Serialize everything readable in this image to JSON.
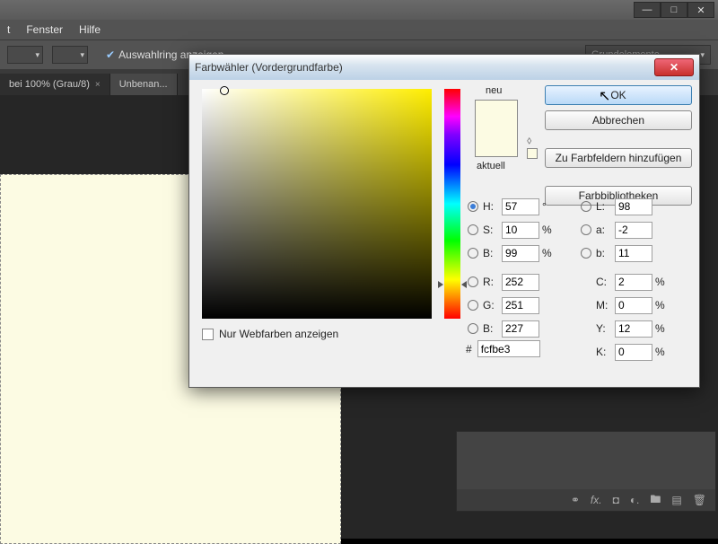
{
  "menu": {
    "fenster": "Fenster",
    "hilfe": "Hilfe"
  },
  "options": {
    "auswahlring": "Auswahlring anzeigen",
    "preset": "Grundelemente"
  },
  "tabs": {
    "t1": "bei 100% (Grau/8)",
    "t2": "Unbenan..."
  },
  "dialog": {
    "title": "Farbwähler (Vordergrundfarbe)",
    "ok": "OK",
    "cancel": "Abbrechen",
    "addswatch": "Zu Farbfeldern hinzufügen",
    "libs": "Farbbibliotheken",
    "neu": "neu",
    "aktuell": "aktuell",
    "webonly": "Nur Webfarben anzeigen",
    "hash": "#",
    "hex": "fcfbe3",
    "H": {
      "l": "H:",
      "v": "57",
      "u": "°"
    },
    "S": {
      "l": "S:",
      "v": "10",
      "u": "%"
    },
    "Bhsb": {
      "l": "B:",
      "v": "99",
      "u": "%"
    },
    "R": {
      "l": "R:",
      "v": "252"
    },
    "G": {
      "l": "G:",
      "v": "251"
    },
    "Brgb": {
      "l": "B:",
      "v": "227"
    },
    "L": {
      "l": "L:",
      "v": "98"
    },
    "a": {
      "l": "a:",
      "v": "-2"
    },
    "b": {
      "l": "b:",
      "v": "11"
    },
    "C": {
      "l": "C:",
      "v": "2",
      "u": "%"
    },
    "M": {
      "l": "M:",
      "v": "0",
      "u": "%"
    },
    "Y": {
      "l": "Y:",
      "v": "12",
      "u": "%"
    },
    "K": {
      "l": "K:",
      "v": "0",
      "u": "%"
    }
  },
  "colors": {
    "swatch": "#fcfbe3"
  }
}
